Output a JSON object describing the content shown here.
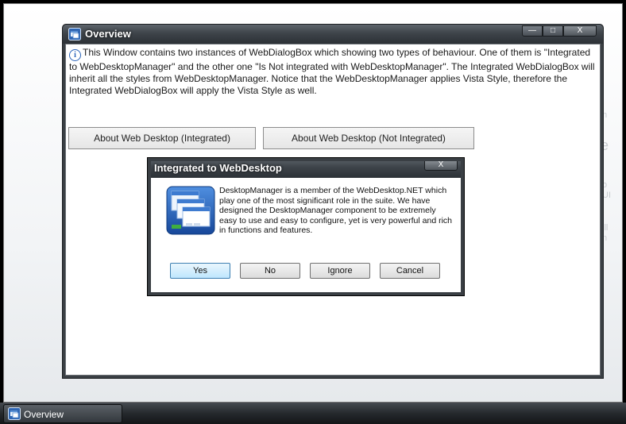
{
  "main_window": {
    "title": "Overview",
    "minimize": "—",
    "maximize": "□",
    "close": "X",
    "description": "This Window contains two instances of WebDialogBox which showing two types of behaviour. One of them is \"Integrated to WebDesktopManager\" and the other one \"Is Not integrated with WebDesktopManager\". The Integrated WebDialogBox will inherit all the styles from WebDesktopManager. Notice that the WebDesktopManager applies Vista Style, therefore the Integrated WebDialogBox will apply the Vista Style as well.",
    "buttons": {
      "integrated": "About Web Desktop (Integrated)",
      "not_integrated": "About Web Desktop (Not Integrated)"
    }
  },
  "dialog": {
    "title": "Integrated to WebDesktop",
    "close": "X",
    "message": "DesktopManager is a member of the WebDesktop.NET which play one of the most significant role in the suite. We have designed the DesktopManager component to be extremely easy to use and easy to configure, yet is very powerful and rich in functions and features.",
    "buttons": [
      "Yes",
      "No",
      "Ignore",
      "Cancel"
    ],
    "icon": "desktop-windows-icon"
  },
  "background_fragments": [
    "m",
    "e",
    "o",
    "UI",
    "ill",
    "n"
  ],
  "taskbar": {
    "items": [
      {
        "label": "Overview",
        "icon": "window-app-icon"
      }
    ]
  },
  "colors": {
    "title_bar": "#3e444a",
    "default_button": "#bee6fd",
    "taskbar": "#25292d"
  }
}
